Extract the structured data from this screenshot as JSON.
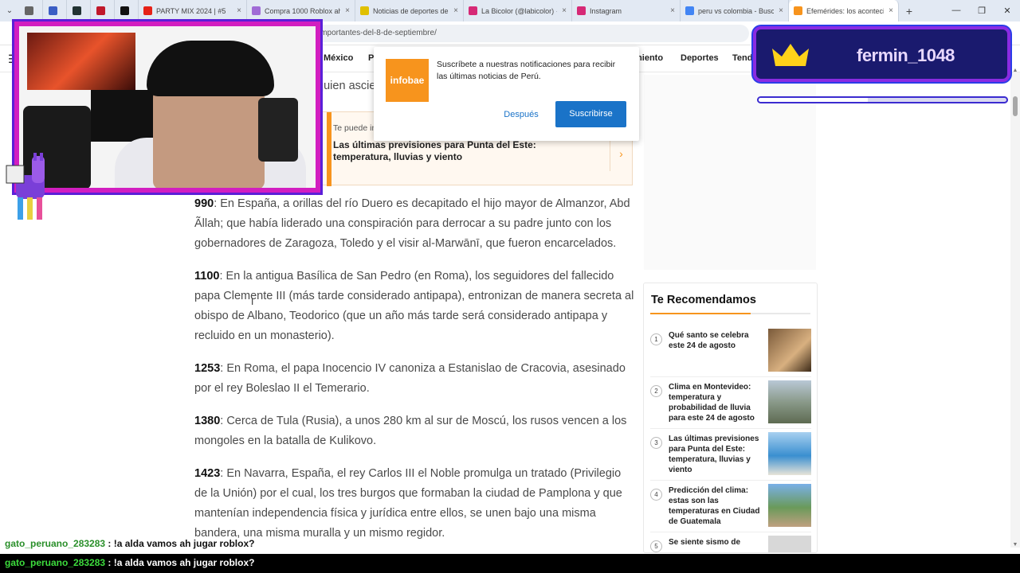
{
  "tabs": [
    {
      "icon": "generic-icon",
      "color": "#666",
      "label": "",
      "pinned": true
    },
    {
      "icon": "download-icon",
      "color": "#3b5ec4",
      "label": "",
      "pinned": true
    },
    {
      "icon": "app-icon",
      "color": "#233",
      "label": "",
      "pinned": true
    },
    {
      "icon": "record-icon",
      "color": "#c0182a",
      "label": "",
      "pinned": true
    },
    {
      "icon": "kick-icon",
      "color": "#111",
      "label": "",
      "pinned": true
    },
    {
      "icon": "youtube-icon",
      "color": "#e62117",
      "label": "PARTY MIX 2024 | #5"
    },
    {
      "icon": "roblox-icon",
      "color": "#a06bd6",
      "label": "Compra 1000 Roblox aho"
    },
    {
      "icon": "news-icon",
      "color": "#e0c000",
      "label": "Noticias de deportes de"
    },
    {
      "icon": "instagram-icon",
      "color": "#d62976",
      "label": "La Bicolor (@labicolor) ·"
    },
    {
      "icon": "instagram-icon",
      "color": "#d62976",
      "label": "Instagram"
    },
    {
      "icon": "google-icon",
      "color": "#4285f4",
      "label": "peru vs colombia - Busc"
    },
    {
      "icon": "infobae-icon",
      "color": "#f7941d",
      "label": "Efemérides: los aconteci"
    }
  ],
  "address": {
    "url": "importantes-del-8-de-septiembre/"
  },
  "nav": {
    "items": [
      "México",
      "P",
      "miento",
      "Deportes",
      "Tende"
    ]
  },
  "article": {
    "truncated": ", quien ascie",
    "paragraphs": [
      {
        "year": "990",
        "text": ": En España, a orillas del río Duero es decapitado el hijo mayor de Almanzor, Abd Ãllah; que había liderado una conspiración para derrocar a su padre junto con los gobernadores de Zaragoza, Toledo y el visir al-Marwānī, que fueron encarcelados."
      },
      {
        "year": "1100",
        "text": ": En la antigua Basílica de San Pedro (en Roma), los seguidores del fallecido papa Clemente III (más tarde considerado antipapa), entronizan de manera secreta al obispo de Albano, Teodorico (que un año más tarde será considerado antipapa y recluido en un monasterio)."
      },
      {
        "year": "1253",
        "text": ": En Roma, el papa Inocencio IV canoniza a Estanislao de Cracovia, asesinado por el rey Boleslao II el Temerario."
      },
      {
        "year": "1380",
        "text": ": Cerca de Tula (Rusia), a unos 280 km al sur de Moscú, los rusos vencen a los mongoles en la batalla de Kulikovo."
      },
      {
        "year": "1423",
        "text": ": En Navarra, España, el rey Carlos III el Noble promulga un tratado (Privilegio de la Unión) por el cual, los tres burgos que formaban la ciudad de Pamplona y que mantenían independencia física y jurídica entre ellos, se unen bajo una misma bandera, una misma muralla y un mismo regidor."
      }
    ]
  },
  "related": {
    "kicker": "Te puede in",
    "title": "Las últimas previsiones para Punta del Este: temperatura, lluvias y viento"
  },
  "popup": {
    "logo": "infobae",
    "message": "Suscríbete a nuestras notificaciones para recibir las últimas noticias de Perú.",
    "later": "Después",
    "subscribe": "Suscribirse"
  },
  "sidebar": {
    "title": "Te Recomendamos",
    "items": [
      {
        "num": "1",
        "text": "Qué santo se celebra este 24 de agosto"
      },
      {
        "num": "2",
        "text": "Clima en Montevideo: temperatura y probabilidad de lluvia para este 24 de agosto"
      },
      {
        "num": "3",
        "text": "Las últimas previsiones para Punta del Este: temperatura, lluvias y viento"
      },
      {
        "num": "4",
        "text": "Predicción del clima: estas son las temperaturas en Ciudad de Guatemala"
      },
      {
        "num": "5",
        "text": "Se siente sismo de"
      }
    ]
  },
  "overlay": {
    "sub_name": "fermin_1048",
    "progress": 0.44,
    "chat_user": "gato_peruano_283283",
    "chat_sep": " : ",
    "chat_msg": "!a alda vamos ah jugar roblox?"
  }
}
